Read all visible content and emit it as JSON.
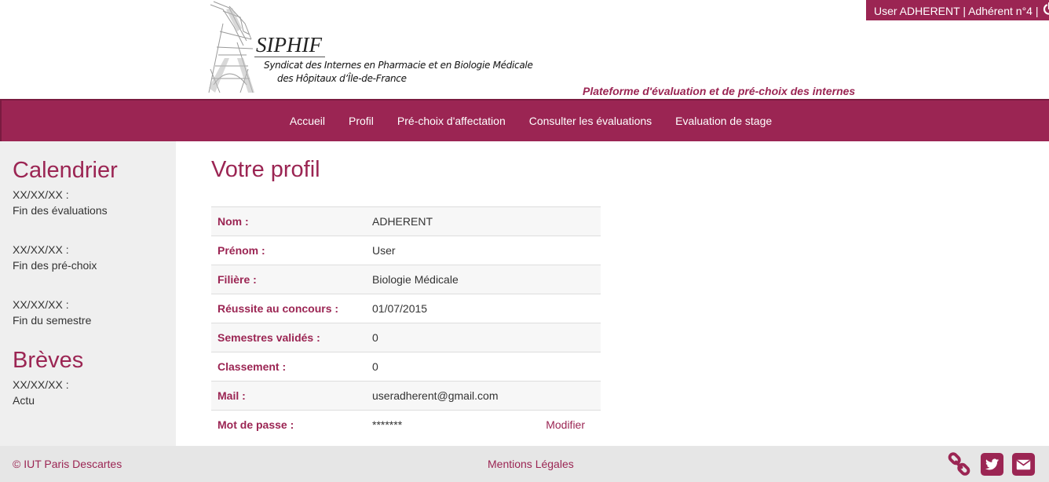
{
  "header": {
    "user_label": "User ADHERENT | Adhérent n°4 |",
    "brand": "SIPHIF",
    "subtitle_line1": "Syndicat des Internes en Pharmacie et en Biologie Médicale",
    "subtitle_line2": "des Hôpitaux d’Île-de-France",
    "tagline": "Plateforme d'évaluation et de pré-choix des internes",
    "accent_color": "#9b2553"
  },
  "nav": {
    "items": [
      "Accueil",
      "Profil",
      "Pré-choix d'affectation",
      "Consulter les évaluations",
      "Evaluation de stage"
    ]
  },
  "sidebar": {
    "calendar_title": "Calendrier",
    "events": [
      {
        "date": "XX/XX/XX :",
        "label": "Fin des évaluations"
      },
      {
        "date": "XX/XX/XX :",
        "label": "Fin des pré-choix"
      },
      {
        "date": "XX/XX/XX :",
        "label": "Fin du semestre"
      }
    ],
    "news_title": "Brèves",
    "news": [
      {
        "date": "XX/XX/XX :",
        "label": "Actu"
      }
    ]
  },
  "main": {
    "title": "Votre profil",
    "rows": [
      {
        "key": "Nom :",
        "value": "ADHERENT"
      },
      {
        "key": "Prénom :",
        "value": "User"
      },
      {
        "key": "Filière :",
        "value": "Biologie Médicale"
      },
      {
        "key": "Réussite au concours :",
        "value": "01/07/2015"
      },
      {
        "key": "Semestres validés :",
        "value": "0"
      },
      {
        "key": "Classement :",
        "value": "0"
      },
      {
        "key": "Mail :",
        "value": "useradherent@gmail.com"
      },
      {
        "key": "Mot de passe :",
        "value": "*******",
        "action": "Modifier"
      }
    ]
  },
  "footer": {
    "copyright": "© IUT Paris Descartes",
    "legal": "Mentions Légales",
    "icons": [
      "link-icon",
      "twitter-icon",
      "mail-icon"
    ]
  }
}
